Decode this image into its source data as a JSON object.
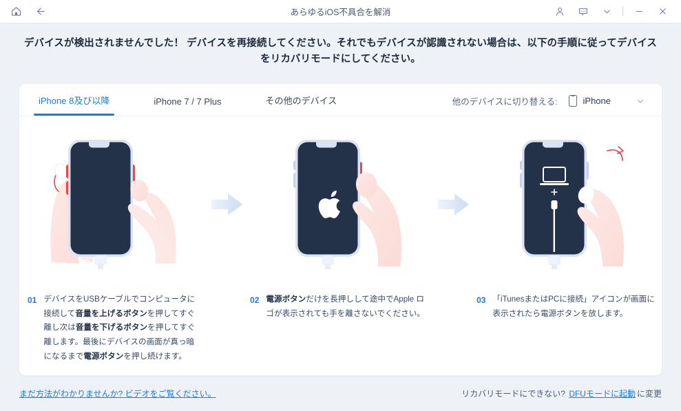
{
  "titlebar": {
    "title": "あらゆるiOS不具合を解消",
    "icons": {
      "home": "home-icon",
      "back": "back-arrow-icon",
      "account": "user-icon",
      "feedback": "message-icon",
      "more": "chevron-down-icon",
      "minimize": "minimize-icon",
      "close": "close-icon"
    }
  },
  "headline": "デバイスが検出されませんでした！ デバイスを再接続してください。それでもデバイスが認識されない場合は、以下の手順に従ってデバイスをリカバリモードにしてください。",
  "tabs": [
    {
      "label": "iPhone 8及び以降",
      "active": true
    },
    {
      "label": "iPhone 7 / 7 Plus",
      "active": false
    },
    {
      "label": "その他のデバイス",
      "active": false
    }
  ],
  "switcher": {
    "label": "他のデバイスに切り替える:",
    "value": "iPhone",
    "icon": "phone-icon",
    "caret": "chevron-down-icon"
  },
  "steps": [
    {
      "number": "01",
      "text_parts": [
        {
          "t": "デバイスをUSBケーブルでコンピュータに接続して",
          "b": false
        },
        {
          "t": "音量を上げるボタン",
          "b": true
        },
        {
          "t": "を押してすぐ離し次は",
          "b": false
        },
        {
          "t": "音量を下げるボタン",
          "b": true
        },
        {
          "t": "を押してすぐ離します。最後にデバイスの画面が真っ暗になるまで",
          "b": false
        },
        {
          "t": "電源ボタン",
          "b": true
        },
        {
          "t": "を押し続けます。",
          "b": false
        }
      ],
      "illustration": "two-hands-pressing-phone-buttons"
    },
    {
      "number": "02",
      "text_parts": [
        {
          "t": "電源ボタン",
          "b": true
        },
        {
          "t": "だけを長押しして途中でApple ロゴが表示されても手を離さないでください。",
          "b": false
        }
      ],
      "illustration": "hand-holding-power-button-apple-logo"
    },
    {
      "number": "03",
      "text_parts": [
        {
          "t": "「iTunesまたはPCに接続」アイコンが画面に表示されたら電源ボタンを放します。",
          "b": false
        }
      ],
      "illustration": "connect-to-itunes-screen-release-finger"
    }
  ],
  "bottombar": {
    "left_link": "まだ方法がわかりませんか? ビデオをご覧ください。",
    "right_prefix": "リカバリモードにできない?",
    "right_link": "DFUモードに起動",
    "right_suffix": "に変更"
  },
  "colors": {
    "accent": "#1a7ae8",
    "page_bg": "#eef2f7",
    "card_bg": "#ffffff",
    "text": "#3b4a63",
    "heading": "#1e2a3c"
  }
}
